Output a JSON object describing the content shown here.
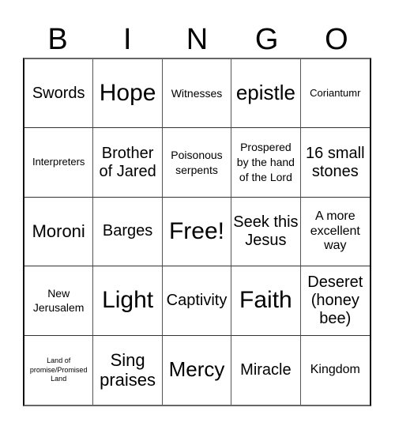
{
  "header": {
    "letters": [
      "B",
      "I",
      "N",
      "G",
      "O"
    ]
  },
  "card": {
    "rows": [
      [
        "Swords",
        "Hope",
        "Witnesses",
        "epistle",
        "Coriantumr"
      ],
      [
        "Interpreters",
        "Brother of Jared",
        "Poisonous serpents",
        "Prospered by the hand of the Lord",
        "16 small stones"
      ],
      [
        "Moroni",
        "Barges",
        "Free!",
        "Seek this Jesus",
        "A more excellent way"
      ],
      [
        "New Jerusalem",
        "Light",
        "Captivity",
        "Faith",
        "Deseret (honey bee)"
      ],
      [
        "Land of promise/Promised Land",
        "Sing praises",
        "Mercy",
        "Miracle",
        "Kingdom"
      ]
    ],
    "free_space_label": "Free!"
  },
  "colors": {
    "background": "#ffffff",
    "text": "#000000",
    "grid_line": "#333333"
  }
}
